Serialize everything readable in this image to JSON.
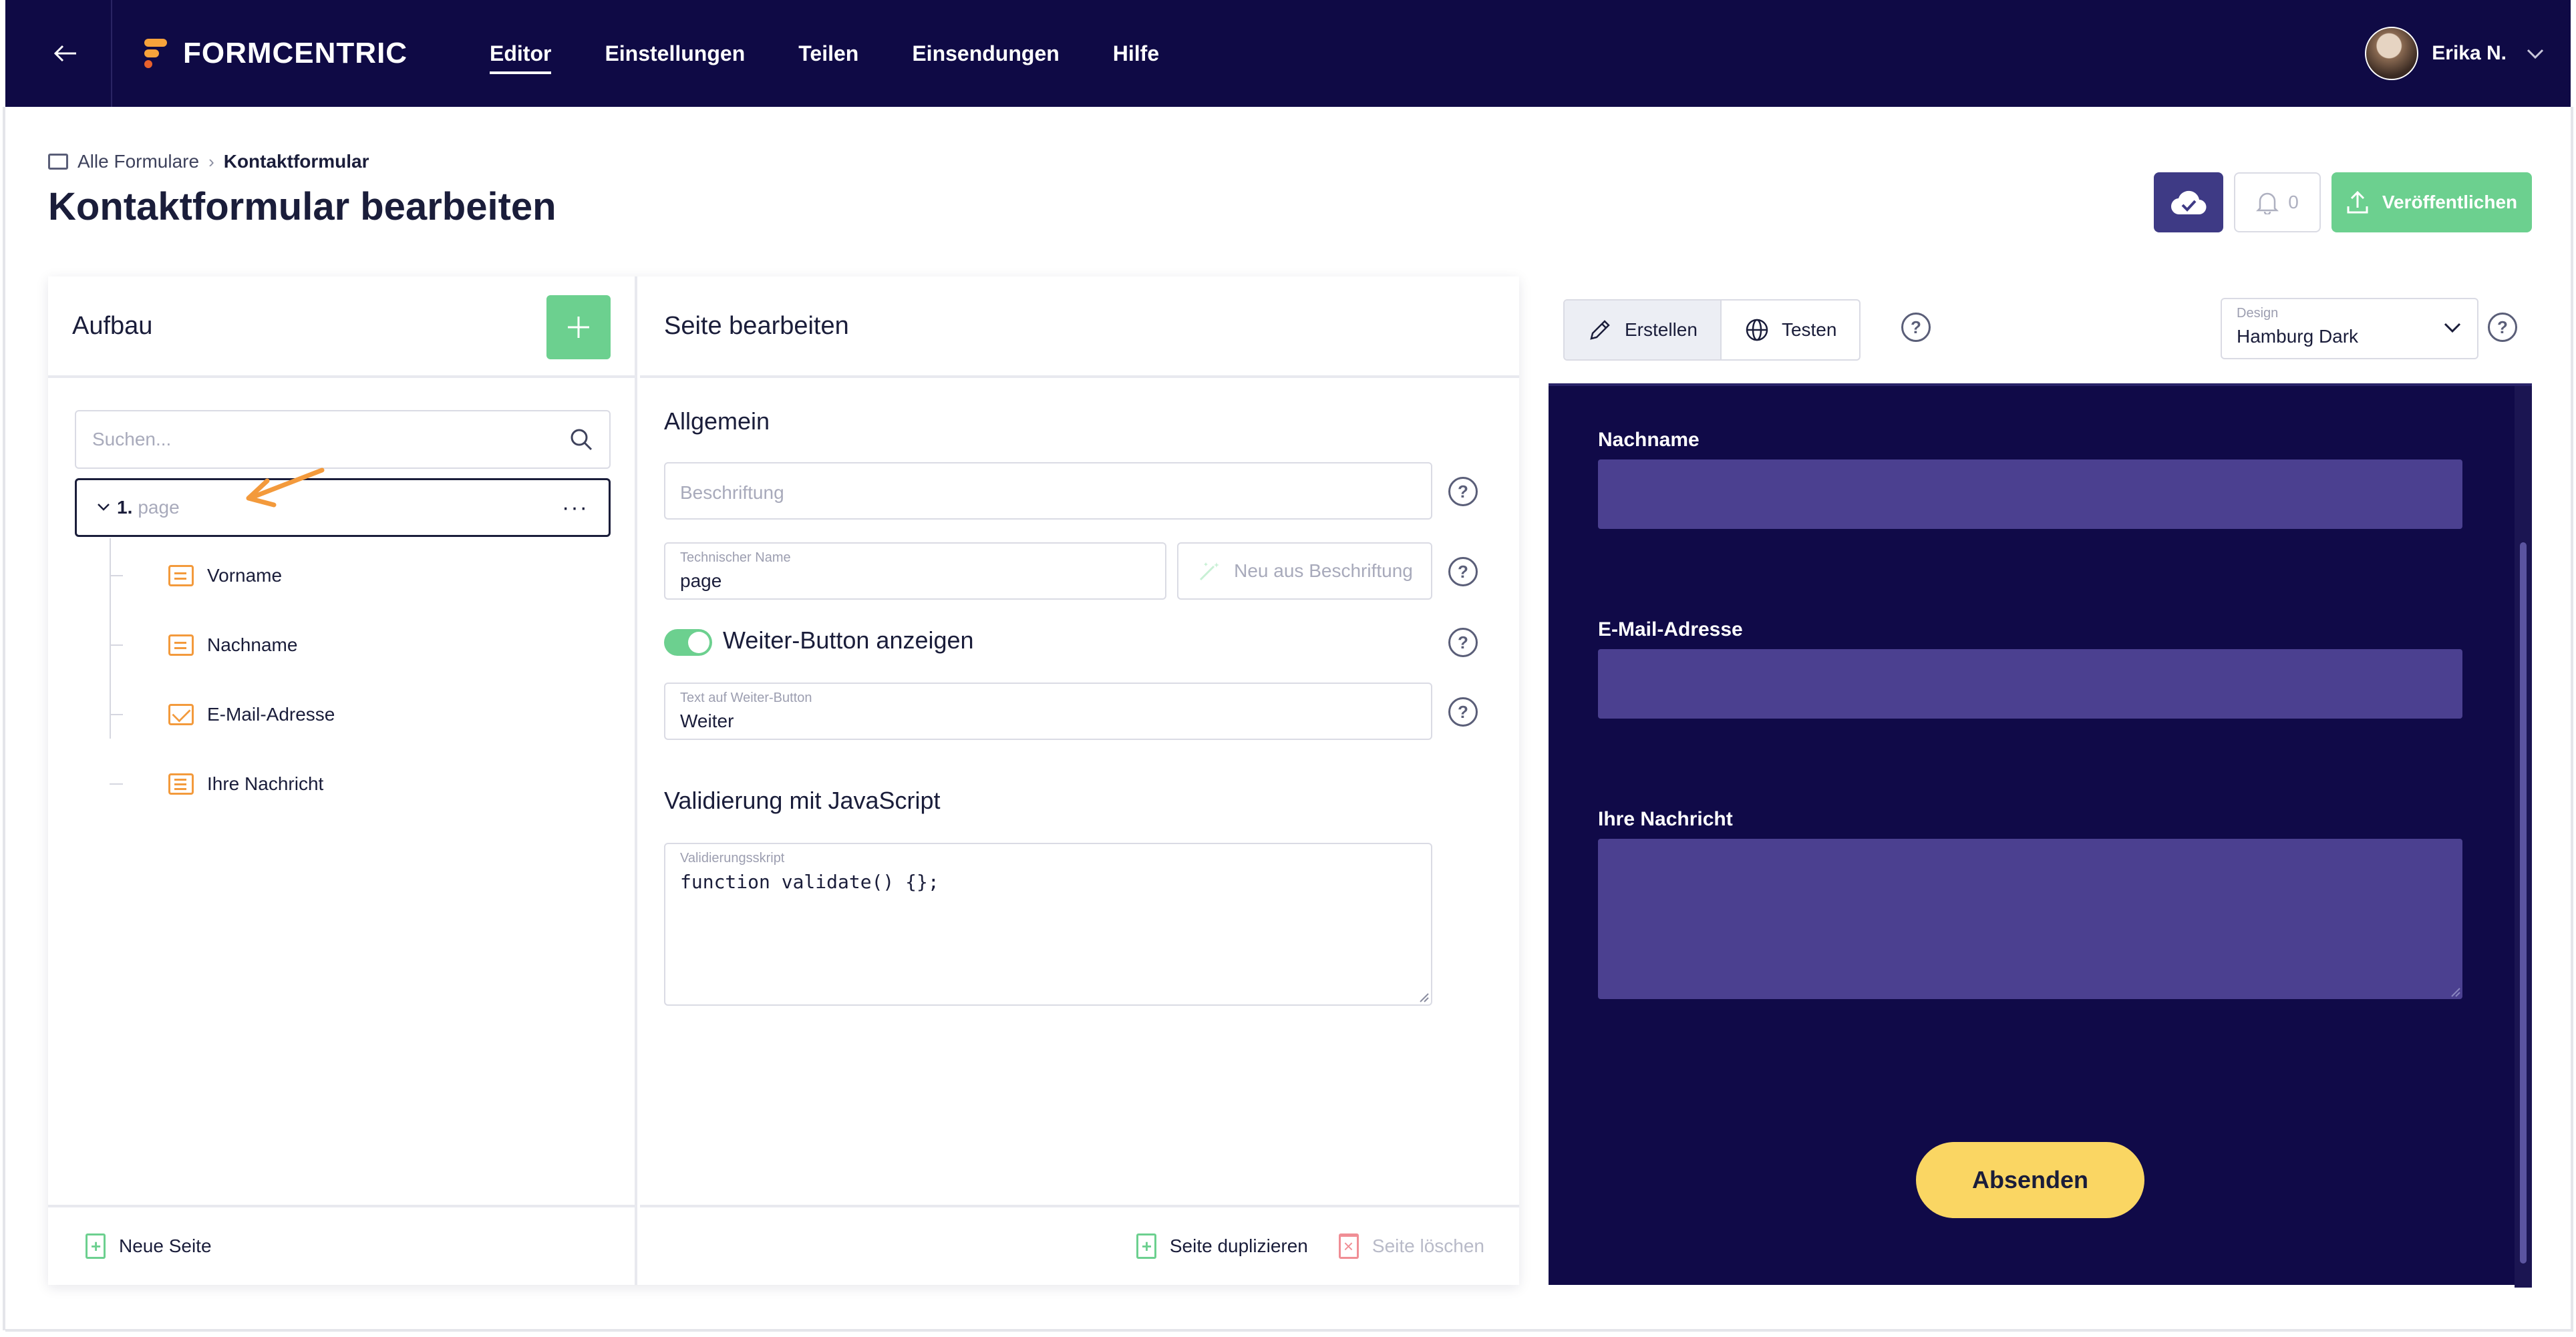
{
  "app": {
    "brand": "FORMCENTRIC",
    "nav": [
      {
        "label": "Editor",
        "active": true
      },
      {
        "label": "Einstellungen",
        "active": false
      },
      {
        "label": "Teilen",
        "active": false
      },
      {
        "label": "Einsendungen",
        "active": false
      },
      {
        "label": "Hilfe",
        "active": false
      }
    ],
    "user_name": "Erika N."
  },
  "header": {
    "breadcrumb_root": "Alle Formulare",
    "breadcrumb_current": "Kontaktformular",
    "title": "Kontaktformular bearbeiten",
    "notification_count": "0",
    "publish_label": "Veröffentlichen"
  },
  "structure": {
    "title": "Aufbau",
    "search_placeholder": "Suchen...",
    "page_number": "1.",
    "page_label": "page",
    "fields": [
      "Vorname",
      "Nachname",
      "E-Mail-Adresse",
      "Ihre Nachricht"
    ],
    "new_page_label": "Neue Seite"
  },
  "editor": {
    "title": "Seite bearbeiten",
    "section_general": "Allgemein",
    "caption_placeholder": "Beschriftung",
    "technical_name_caption": "Technischer Name",
    "technical_name_value": "page",
    "from_caption_label": "Neu aus Beschriftung",
    "next_button_toggle_label": "Weiter-Button anzeigen",
    "next_button_toggle_on": true,
    "next_button_text_caption": "Text auf Weiter-Button",
    "next_button_text_value": "Weiter",
    "section_validation": "Validierung mit JavaScript",
    "script_caption": "Validierungsskript",
    "script_value": "function validate() {};",
    "duplicate_label": "Seite duplizieren",
    "delete_label": "Seite löschen"
  },
  "preview": {
    "tab_create": "Erstellen",
    "tab_test": "Testen",
    "design_caption": "Design",
    "design_value": "Hamburg Dark",
    "fields": [
      "Nachname",
      "E-Mail-Adresse",
      "Ihre Nachricht"
    ],
    "submit_label": "Absenden"
  },
  "colors": {
    "topbar": "#0f0a45",
    "accent_green": "#6cd08f",
    "accent_orange": "#f39a3c",
    "preview_bg": "#100a48",
    "preview_input": "#4b4090",
    "submit_yellow": "#fad663"
  }
}
